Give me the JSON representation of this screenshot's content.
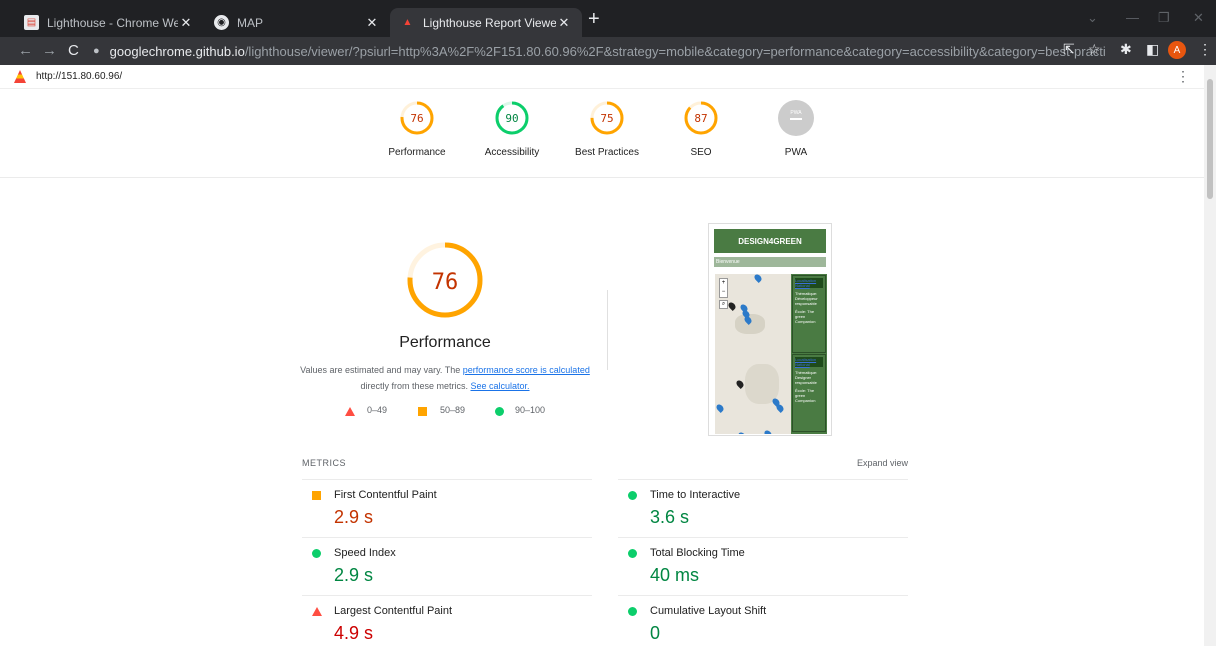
{
  "browser": {
    "tabs": [
      {
        "title": "Lighthouse - Chrome Web Store",
        "icon": "chrome-web-store-icon"
      },
      {
        "title": "MAP",
        "icon": "globe-icon"
      },
      {
        "title": "Lighthouse Report Viewer",
        "icon": "lighthouse-icon",
        "active": true
      }
    ],
    "url_host": "googlechrome.github.io",
    "url_path": "/lighthouse/viewer/?psiurl=http%3A%2F%2F151.80.60.96%2F&strategy=mobile&category=performance&category=accessibility&category=best-practices&category...",
    "profile_initial": "A"
  },
  "report": {
    "url": "http://151.80.60.96/",
    "gauges": [
      {
        "label": "Performance",
        "score": "76",
        "fraction": 0.76,
        "color": "#ffa400",
        "text_color": "#c33300"
      },
      {
        "label": "Accessibility",
        "score": "90",
        "fraction": 0.9,
        "color": "#0cce6b",
        "text_color": "#018642"
      },
      {
        "label": "Best Practices",
        "score": "75",
        "fraction": 0.75,
        "color": "#ffa400",
        "text_color": "#c33300"
      },
      {
        "label": "SEO",
        "score": "87",
        "fraction": 0.87,
        "color": "#ffa400",
        "text_color": "#c33300"
      },
      {
        "label": "PWA",
        "score": "PWA",
        "fraction": 0,
        "color": "#cccccc",
        "text_color": "#ffffff"
      }
    ],
    "main": {
      "score": "76",
      "fraction": 0.76,
      "title": "Performance",
      "desc_1": "Values are estimated and may vary. The ",
      "desc_link_1": "performance score is calculated",
      "desc_2": " directly from these metrics. ",
      "desc_link_2": "See calculator."
    },
    "legend": [
      {
        "range": "0–49",
        "shape": "triangle",
        "color": "#ff4e42"
      },
      {
        "range": "50–89",
        "shape": "square",
        "color": "#ffa400"
      },
      {
        "range": "90–100",
        "shape": "circle",
        "color": "#0cce6b"
      }
    ],
    "screenshot": {
      "header": "DESIGN4GREEN",
      "subheader": "Bienvenue",
      "card_1": {
        "link": "Localisation National",
        "text": "Thématique: Développeur responsable",
        "ecole": "École: The green Companion"
      },
      "card_2": {
        "link": "Localisation National",
        "text": "Thématique: Designer responsable",
        "ecole": "École: The green Companion"
      }
    },
    "metrics_label": "METRICS",
    "expand_label": "Expand view",
    "metrics": [
      {
        "name": "First Contentful Paint",
        "value": "2.9 s",
        "rating": "average"
      },
      {
        "name": "Time to Interactive",
        "value": "3.6 s",
        "rating": "pass"
      },
      {
        "name": "Speed Index",
        "value": "2.9 s",
        "rating": "pass"
      },
      {
        "name": "Total Blocking Time",
        "value": "40 ms",
        "rating": "pass"
      },
      {
        "name": "Largest Contentful Paint",
        "value": "4.9 s",
        "rating": "fail"
      },
      {
        "name": "Cumulative Layout Shift",
        "value": "0",
        "rating": "pass"
      }
    ]
  }
}
